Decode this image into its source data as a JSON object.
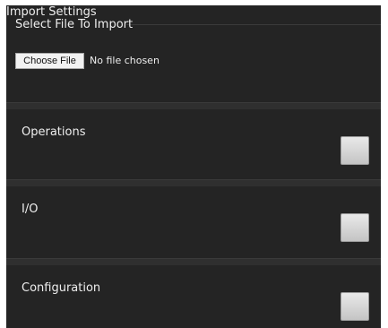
{
  "panel": {
    "title": "Import Settings"
  },
  "file_import": {
    "legend": "Select File To Import",
    "button_label": "Choose File",
    "status": "No file chosen"
  },
  "sections": [
    {
      "label": "Operations",
      "checked": false
    },
    {
      "label": "I/O",
      "checked": false
    },
    {
      "label": "Configuration",
      "checked": false
    }
  ],
  "colors": {
    "panel_background": "#242424",
    "text": "#eeeeee"
  }
}
